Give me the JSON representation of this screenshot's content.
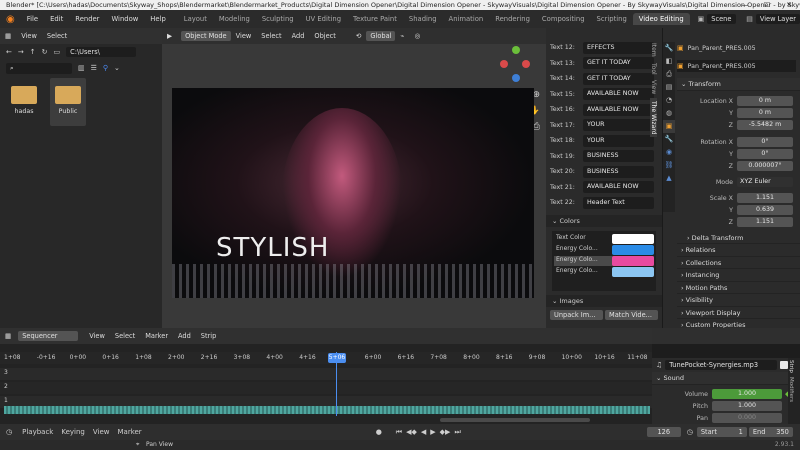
{
  "title_bar": {
    "text": "Blender* [C:\\Users\\hadas\\Documents\\Skyway_Shops\\Blendermarket\\Blendermarket_Products\\Digital Dimension Opener\\Digital Dimension Opener - SkywayVisuals\\Digital Dimension Opener - By SkywayVisuals\\Digital Dimension Opener - by SkywayVisuals.b...",
    "minimize": "—",
    "maximize": "☐",
    "close": "✕"
  },
  "menu": {
    "items": [
      "File",
      "Edit",
      "Render",
      "Window",
      "Help"
    ],
    "workspaces": [
      "Layout",
      "Modeling",
      "Sculpting",
      "UV Editing",
      "Texture Paint",
      "Shading",
      "Animation",
      "Rendering",
      "Compositing",
      "Scripting",
      "Video Editing"
    ],
    "active_workspace": "Video Editing",
    "scene": "Scene",
    "view_layer": "View Layer"
  },
  "file_browser": {
    "header": [
      "View",
      "Select"
    ],
    "path": "C:\\Users\\",
    "folders": [
      "hadas",
      "Public"
    ]
  },
  "viewport": {
    "header": [
      "Object Mode",
      "View",
      "Select",
      "Add",
      "Object"
    ],
    "transform": "Global",
    "overlay_text": "STYLISH"
  },
  "sequence_props": {
    "texts": [
      {
        "label": "Text 12:",
        "value": "EFFECTS"
      },
      {
        "label": "Text 13:",
        "value": "GET IT TODAY"
      },
      {
        "label": "Text 14:",
        "value": "GET IT TODAY"
      },
      {
        "label": "Text 15:",
        "value": "AVAILABLE NOW"
      },
      {
        "label": "Text 16:",
        "value": "AVAILABLE NOW"
      },
      {
        "label": "Text 17:",
        "value": "YOUR"
      },
      {
        "label": "Text 18:",
        "value": "YOUR"
      },
      {
        "label": "Text 19:",
        "value": "BUSINESS"
      },
      {
        "label": "Text 20:",
        "value": "BUSINESS"
      },
      {
        "label": "Text 21:",
        "value": "AVAILABLE NOW"
      },
      {
        "label": "Text 22:",
        "value": "Header Text"
      }
    ],
    "colors_header": "Colors",
    "colors": [
      {
        "label": "Text Color",
        "color": "#ffffff"
      },
      {
        "label": "Energy Colo...",
        "color": "#2a8be6"
      },
      {
        "label": "Energy Colo...",
        "color": "#e84aa0"
      },
      {
        "label": "Energy Colo...",
        "color": "#8cc6f2"
      }
    ],
    "images_header": "Images",
    "unpack": "Unpack Im...",
    "match": "Match Vide...",
    "tabs": [
      "Item",
      "Tool",
      "View",
      "The Wizard"
    ]
  },
  "object_props": {
    "object_name": "Pan_Parent_PRES.005",
    "data_name": "Pan_Parent_PRES.005",
    "transform_header": "Transform",
    "location": {
      "label": "Location X",
      "x": "0 m",
      "y": "0 m",
      "z": "-5.5482 m"
    },
    "rotation": {
      "label": "Rotation X",
      "x": "0°",
      "y": "0°",
      "z": "0.000007°"
    },
    "mode": {
      "label": "Mode",
      "value": "XYZ Euler"
    },
    "scale": {
      "label": "Scale X",
      "x": "1.151",
      "y": "0.639",
      "z": "1.151"
    },
    "axis_y": "Y",
    "axis_z": "Z",
    "sections": [
      "Delta Transform",
      "Relations",
      "Collections",
      "Instancing",
      "Motion Paths",
      "Visibility",
      "Viewport Display",
      "Custom Properties"
    ]
  },
  "sequencer": {
    "editor": "Sequencer",
    "menu": [
      "View",
      "Select",
      "Marker",
      "Add",
      "Strip"
    ],
    "ticks": [
      "1+08",
      "-0+16",
      "0+00",
      "0+16",
      "1+08",
      "2+00",
      "2+16",
      "3+08",
      "4+00",
      "4+16",
      "5+06",
      "6+00",
      "6+16",
      "7+08",
      "8+00",
      "8+16",
      "9+08",
      "10+00",
      "10+16",
      "11+08"
    ],
    "current": "5+06",
    "channels": [
      "3",
      "2",
      "1"
    ]
  },
  "strip": {
    "name": "TunePocket-Synergies.mp3",
    "sound_header": "Sound",
    "volume_label": "Volume",
    "volume": "1.000",
    "pitch_label": "Pitch",
    "pitch": "1.000",
    "pan_label": "Pan",
    "pan": "0.000",
    "tabs": [
      "Strip",
      "Modifiers"
    ]
  },
  "playback": {
    "menu": [
      "Playback",
      "Keying",
      "View",
      "Marker"
    ],
    "frame": "126",
    "start_label": "Start",
    "start": "1",
    "end_label": "End",
    "end": "350"
  },
  "status": {
    "hint": "Pan View",
    "version": "2.93.1"
  }
}
